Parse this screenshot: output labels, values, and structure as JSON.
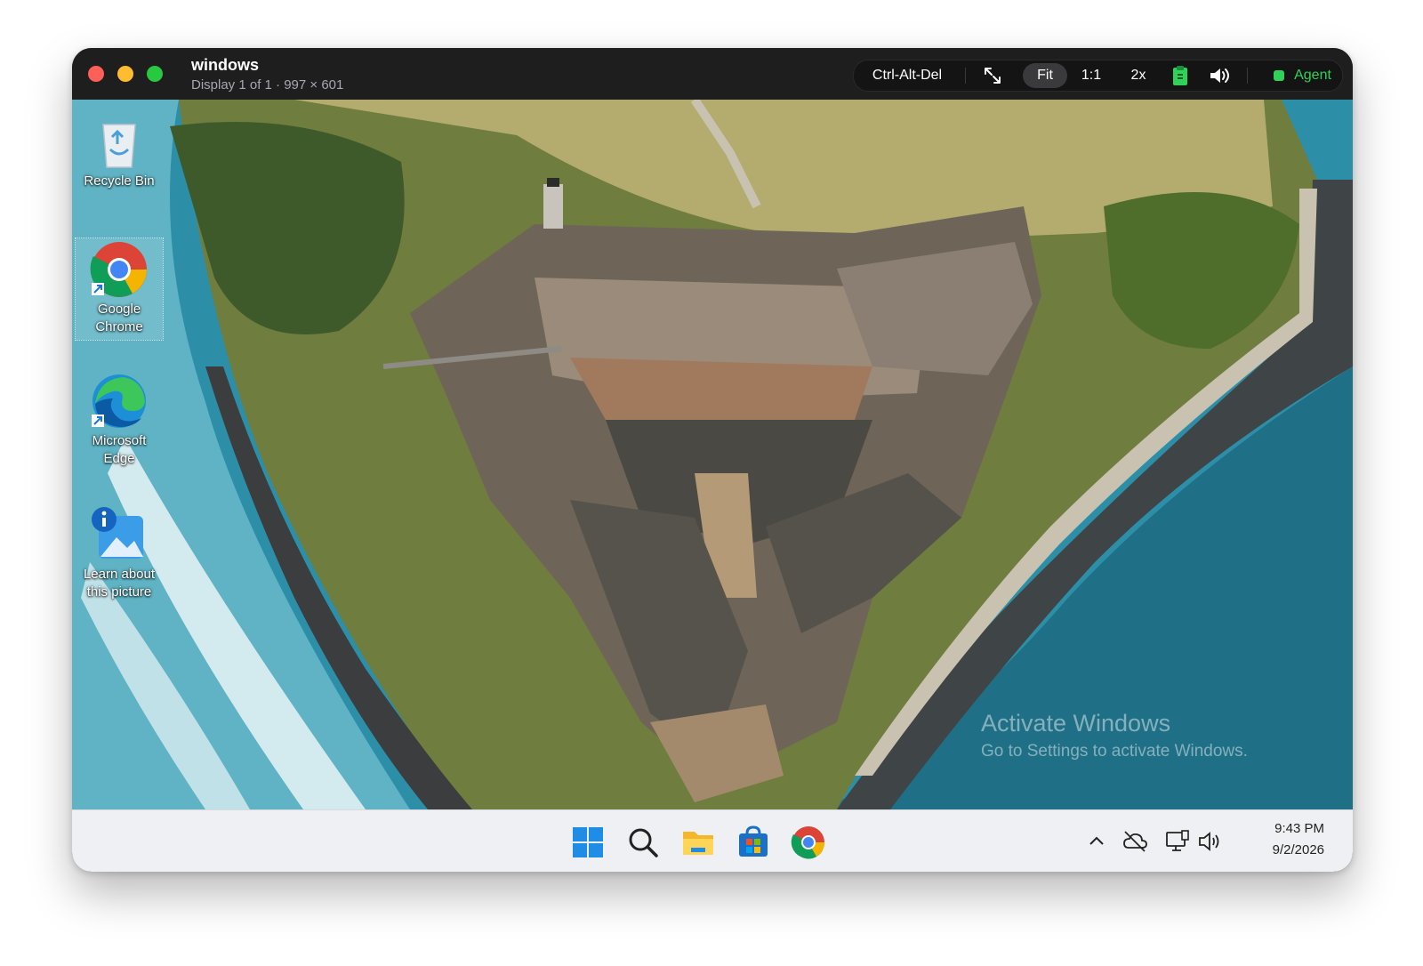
{
  "window": {
    "title": "windows",
    "subtitle": "Display 1 of 1 · 997 × 601"
  },
  "toolbar": {
    "ctrl_alt_del": "Ctrl-Alt-Del",
    "fit": "Fit",
    "one_to_one": "1:1",
    "two_x": "2x",
    "agent": "Agent"
  },
  "desktop": {
    "icons": [
      {
        "label_line1": "Recycle Bin",
        "label_line2": "",
        "icon": "recycle-bin-icon"
      },
      {
        "label_line1": "Google",
        "label_line2": "Chrome",
        "icon": "chrome-icon"
      },
      {
        "label_line1": "Microsoft",
        "label_line2": "Edge",
        "icon": "edge-icon"
      },
      {
        "label_line1": "Learn about",
        "label_line2": "this picture",
        "icon": "learn-picture-icon"
      }
    ],
    "watermark_title": "Activate Windows",
    "watermark_sub": "Go to Settings to activate Windows."
  },
  "taskbar": {
    "time": "9:43 PM",
    "date": "9/2/2026",
    "apps": [
      "start-icon",
      "search-icon",
      "file-explorer-icon",
      "microsoft-store-icon",
      "chrome-icon"
    ],
    "tray": [
      "chevron-up-icon",
      "cloud-offline-icon",
      "network-icon",
      "volume-icon"
    ]
  },
  "colors": {
    "close": "#fe5f57",
    "minimize": "#febc2e",
    "maximize": "#28c840",
    "agent": "#30d158",
    "titlebar": "#1e1e1f"
  }
}
